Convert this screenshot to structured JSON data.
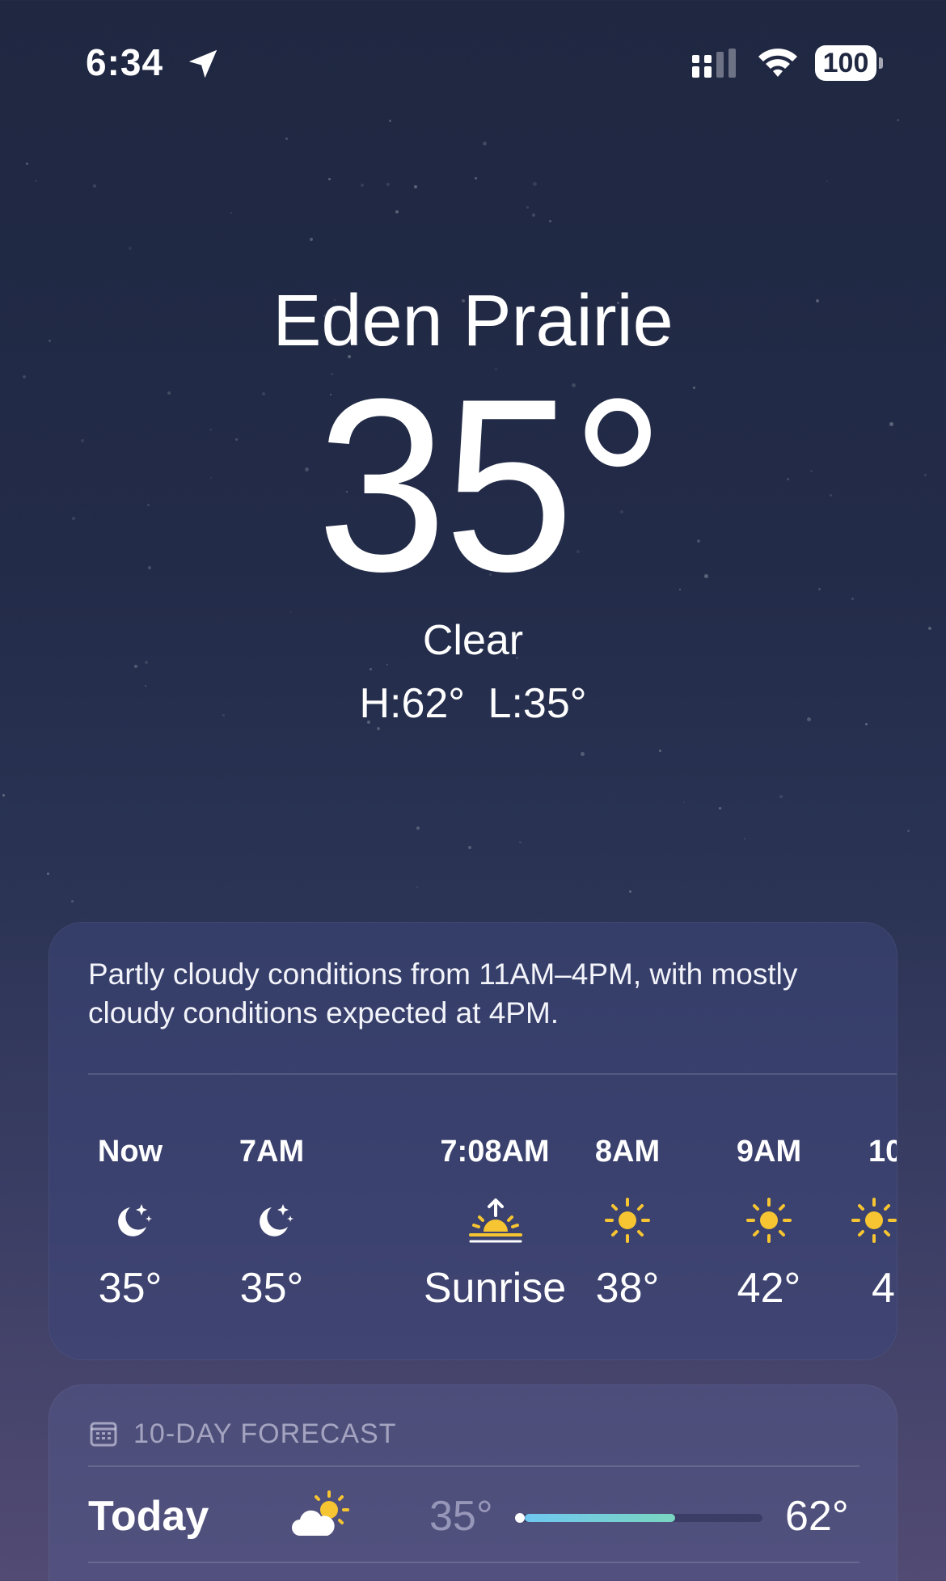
{
  "status_bar": {
    "time": "6:34",
    "battery": "100",
    "icons": [
      "location-arrow-icon",
      "cellular-signal-icon",
      "wifi-icon",
      "battery-icon"
    ]
  },
  "current": {
    "city": "Eden Prairie",
    "temperature": "35°",
    "condition": "Clear",
    "high_low": "H:62°  L:35°"
  },
  "hourly": {
    "summary": "Partly cloudy conditions from 11AM–4PM, with mostly cloudy conditions expected at 4PM.",
    "items": [
      {
        "time": "Now",
        "icon": "moon-stars-icon",
        "temp": "35°"
      },
      {
        "time": "7AM",
        "icon": "moon-stars-icon",
        "temp": "35°"
      },
      {
        "time": "7:08AM",
        "icon": "sunrise-icon",
        "temp": "Sunrise"
      },
      {
        "time": "8AM",
        "icon": "sun-icon",
        "temp": "38°"
      },
      {
        "time": "9AM",
        "icon": "sun-icon",
        "temp": "42°"
      },
      {
        "time": "10",
        "icon": "sun-icon",
        "temp": "4"
      }
    ]
  },
  "forecast": {
    "title": "10-DAY FORECAST",
    "icon": "calendar-icon",
    "days": [
      {
        "day": "Today",
        "icon": "partly-cloudy-day-icon",
        "low": "35°",
        "high": "62°",
        "range_fraction": 0.62
      }
    ]
  },
  "colors": {
    "sun": "#f7c531",
    "range_start": "#6fc7f0",
    "range_end": "#7ad6c0"
  }
}
